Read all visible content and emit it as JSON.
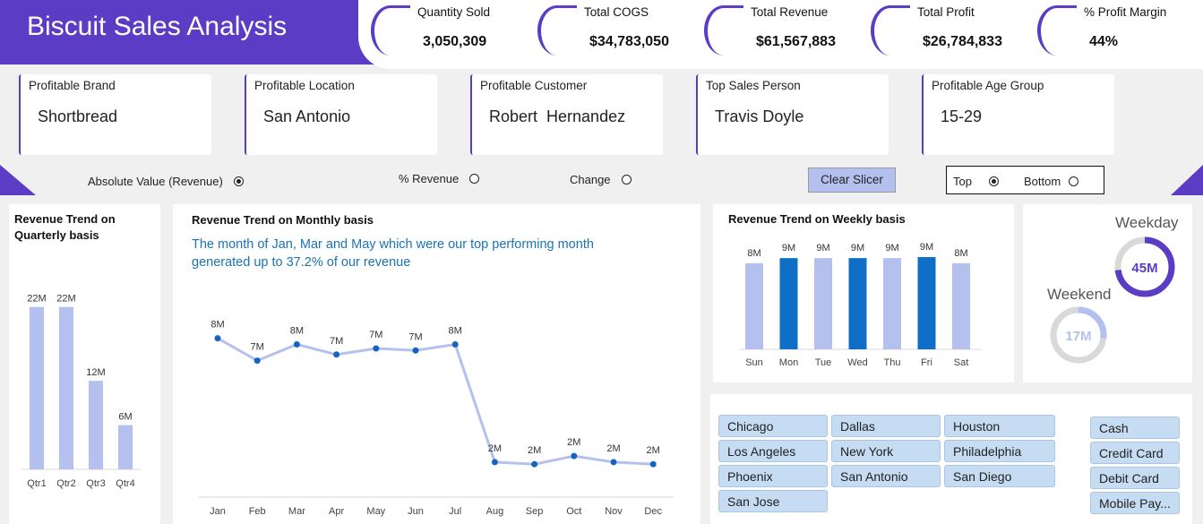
{
  "header": {
    "title": "Biscuit Sales Analysis"
  },
  "kpis": [
    {
      "label": "Quantity Sold",
      "value": "3,050,309"
    },
    {
      "label": "Total COGS",
      "value": "$34,783,050"
    },
    {
      "label": "Total Revenue",
      "value": "$61,567,883"
    },
    {
      "label": "Total Profit",
      "value": "$26,784,833"
    },
    {
      "label": "% Profit Margin",
      "value": "44%"
    }
  ],
  "cards": [
    {
      "label": "Profitable Brand",
      "value": "Shortbread"
    },
    {
      "label": "Profitable Location",
      "value": "San Antonio"
    },
    {
      "label": "Profitable Customer",
      "value": "Robert  Hernandez"
    },
    {
      "label": "Top Sales Person",
      "value": "Travis Doyle"
    },
    {
      "label": "Profitable Age Group",
      "value": "15-29"
    }
  ],
  "options": {
    "absolute": "Absolute Value (Revenue)",
    "percent": "% Revenue",
    "change": "Change",
    "selected": "absolute",
    "clear_slicer": "Clear Slicer",
    "top": "Top",
    "bottom": "Bottom",
    "top_bottom_selected": "top"
  },
  "colors": {
    "accent": "#5b3cc4",
    "bar_light": "#b4c1ef",
    "bar_dark": "#0f6fc6",
    "line": "#b4c1ef",
    "point": "#1565c0",
    "subtitle": "#1a73b5"
  },
  "quarterly": {
    "title_line1": "Revenue Trend on",
    "title_line2": "Quarterly basis"
  },
  "monthly": {
    "title": "Revenue Trend on Monthly basis",
    "subtitle_line1": "The month of Jan, Mar and May  which were our top performing month",
    "subtitle_line2": "generated up to 37.2% of our revenue"
  },
  "weekly": {
    "title": "Revenue Trend on Weekly basis"
  },
  "donuts": {
    "weekday": {
      "label": "Weekday",
      "value": "45M",
      "fraction": 0.73
    },
    "weekend": {
      "label": "Weekend",
      "value": "17M",
      "fraction": 0.27
    }
  },
  "city_slicer": [
    "Chicago",
    "Dallas",
    "Houston",
    "Los Angeles",
    "New York",
    "Philadelphia",
    "Phoenix",
    "San Antonio",
    "San Diego",
    "San Jose"
  ],
  "payment_slicer": [
    "Cash",
    "Credit Card",
    "Debit Card",
    "Mobile Pay..."
  ],
  "chart_data": [
    {
      "type": "bar",
      "title": "Revenue Trend on Quarterly basis",
      "categories": [
        "Qtr1",
        "Qtr2",
        "Qtr3",
        "Qtr4"
      ],
      "values": [
        22,
        22,
        12,
        6
      ],
      "labels": [
        "22M",
        "22M",
        "12M",
        "6M"
      ],
      "ylim": [
        0,
        25
      ],
      "grid": false
    },
    {
      "type": "line",
      "title": "Revenue Trend on Monthly basis",
      "categories": [
        "Jan",
        "Feb",
        "Mar",
        "Apr",
        "May",
        "Jun",
        "Jul",
        "Aug",
        "Sep",
        "Oct",
        "Nov",
        "Dec"
      ],
      "values": [
        8.0,
        6.9,
        7.7,
        7.2,
        7.5,
        7.4,
        7.7,
        1.9,
        1.8,
        2.2,
        1.9,
        1.8
      ],
      "labels": [
        "8M",
        "7M",
        "8M",
        "7M",
        "7M",
        "7M",
        "8M",
        "2M",
        "2M",
        "2M",
        "2M",
        "2M"
      ],
      "ylim": [
        0,
        9
      ],
      "grid": false
    },
    {
      "type": "bar",
      "title": "Revenue Trend on Weekly basis",
      "categories": [
        "Sun",
        "Mon",
        "Tue",
        "Wed",
        "Thu",
        "Fri",
        "Sat"
      ],
      "values": [
        8.4,
        8.9,
        8.9,
        8.9,
        8.9,
        9.0,
        8.4
      ],
      "labels": [
        "8M",
        "9M",
        "9M",
        "9M",
        "9M",
        "9M",
        "8M"
      ],
      "highlight": [
        false,
        true,
        false,
        true,
        false,
        true,
        false
      ],
      "ylim": [
        0,
        9
      ],
      "grid": false
    }
  ]
}
